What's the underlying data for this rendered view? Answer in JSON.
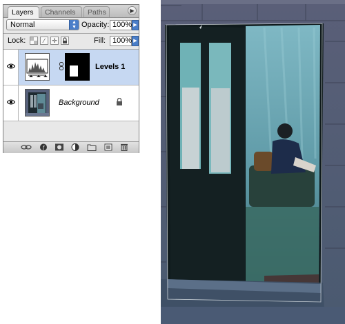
{
  "palette": {
    "tabs": [
      {
        "label": "Layers",
        "active": true
      },
      {
        "label": "Channels",
        "active": false
      },
      {
        "label": "Paths",
        "active": false
      }
    ],
    "menu_icon": "triangle-right-icon",
    "blend_mode": "Normal",
    "opacity_label": "Opacity:",
    "opacity_value": "100%",
    "lock_label": "Lock:",
    "lock_icons": [
      "lock-transparent-icon",
      "lock-image-icon",
      "lock-position-icon",
      "lock-all-icon"
    ],
    "fill_label": "Fill:",
    "fill_value": "100%",
    "layers": [
      {
        "name": "Levels 1",
        "selected": true,
        "visible": true,
        "type": "adjustment"
      },
      {
        "name": "Background",
        "selected": false,
        "visible": true,
        "type": "image",
        "locked": true
      }
    ],
    "footer_icons": [
      "link-layers-icon",
      "layer-style-icon",
      "add-mask-icon",
      "new-fill-adjustment-icon",
      "new-group-icon",
      "new-layer-icon",
      "trash-icon"
    ]
  },
  "colors": {
    "selection": "#c6d8f2",
    "accent": "#4a7ec9"
  }
}
